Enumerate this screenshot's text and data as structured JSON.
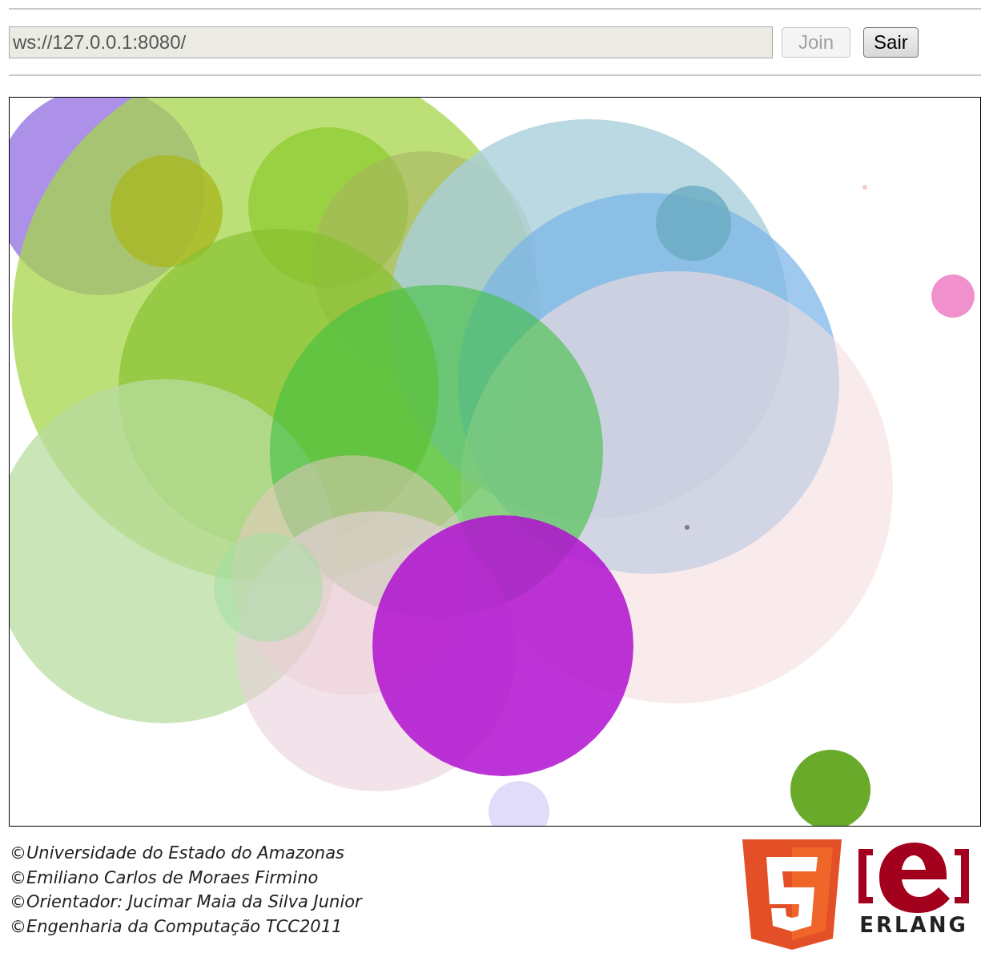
{
  "connection": {
    "url": "ws://127.0.0.1:8080/",
    "buttons": [
      {
        "label": "Join",
        "disabled": true
      },
      {
        "label": "Sair",
        "disabled": false
      }
    ]
  },
  "credits": [
    "©Universidade do Estado do Amazonas",
    "©Emiliano Carlos de Moraes Firmino",
    "©Orientador: Jucimar Maia da Silva Junior",
    "©Engenharia da Computação TCC2011"
  ],
  "logos": {
    "erlang_text": "ERLANG"
  }
}
